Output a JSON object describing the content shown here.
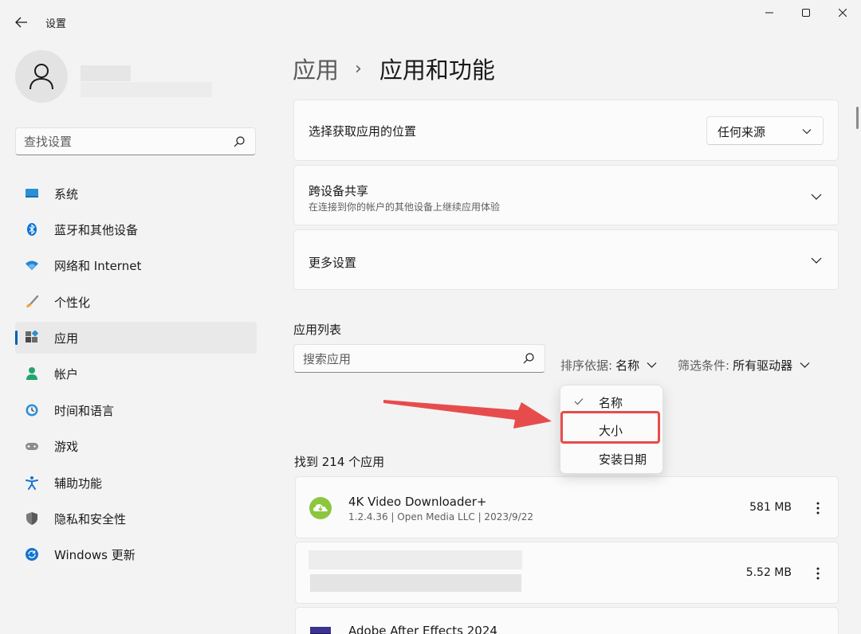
{
  "window": {
    "title": "设置"
  },
  "profile": {},
  "search": {
    "placeholder": "查找设置"
  },
  "nav": {
    "items": [
      {
        "label": "系统",
        "icon": "monitor-icon"
      },
      {
        "label": "蓝牙和其他设备",
        "icon": "bluetooth-icon"
      },
      {
        "label": "网络和 Internet",
        "icon": "wifi-icon"
      },
      {
        "label": "个性化",
        "icon": "brush-icon"
      },
      {
        "label": "应用",
        "icon": "apps-icon",
        "selected": true
      },
      {
        "label": "帐户",
        "icon": "person-icon"
      },
      {
        "label": "时间和语言",
        "icon": "clock-globe-icon"
      },
      {
        "label": "游戏",
        "icon": "gamepad-icon"
      },
      {
        "label": "辅助功能",
        "icon": "accessibility-icon"
      },
      {
        "label": "隐私和安全性",
        "icon": "shield-icon"
      },
      {
        "label": "Windows 更新",
        "icon": "update-icon"
      }
    ]
  },
  "breadcrumb": {
    "parent": "应用",
    "separator": "›",
    "current": "应用和功能"
  },
  "cards": {
    "install_source": {
      "title": "选择获取应用的位置",
      "value": "任何来源"
    },
    "share": {
      "title": "跨设备共享",
      "subtitle": "在连接到你的帐户的其他设备上继续应用体验"
    },
    "more": {
      "title": "更多设置"
    }
  },
  "app_list": {
    "title": "应用列表",
    "search_placeholder": "搜索应用",
    "sort_label": "排序依据:",
    "sort_value": "名称",
    "filter_label": "筛选条件:",
    "filter_value": "所有驱动器",
    "found": "找到 214 个应用",
    "apps": [
      {
        "name": "4K Video Downloader+",
        "meta": "1.2.4.36 | Open Media LLC | 2023/9/22",
        "size": "581 MB",
        "icon": "4k-downloader-icon"
      },
      {
        "name": "",
        "meta": "",
        "size": "5.52 MB",
        "icon": ""
      },
      {
        "name": "Adobe After Effects 2024",
        "meta": "",
        "size": "",
        "icon": "after-effects-icon"
      }
    ]
  },
  "sort_menu": {
    "items": [
      {
        "label": "名称",
        "checked": true
      },
      {
        "label": "大小",
        "highlighted": true
      },
      {
        "label": "安装日期"
      }
    ]
  },
  "colors": {
    "accent": "#005fb8",
    "annotation": "#e74c4c",
    "background": "#f3f3f3"
  }
}
